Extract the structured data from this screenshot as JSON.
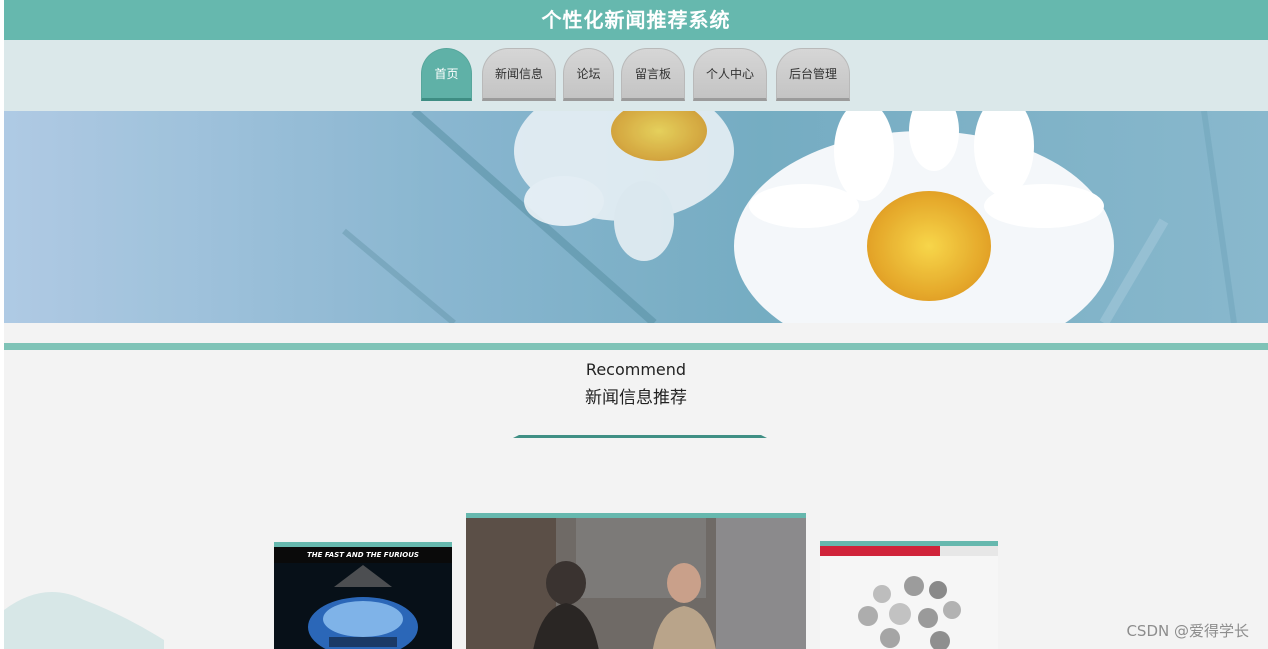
{
  "header": {
    "title": "个性化新闻推荐系统"
  },
  "nav": {
    "items": [
      {
        "label": "首页"
      },
      {
        "label": "新闻信息"
      },
      {
        "label": "论坛"
      },
      {
        "label": "留言板"
      },
      {
        "label": "个人中心"
      },
      {
        "label": "后台管理"
      }
    ]
  },
  "recommend": {
    "title_en": "Recommend",
    "title_zh": "新闻信息推荐"
  },
  "cards": {
    "left_poster_text": "THE FAST AND THE FURIOUS"
  },
  "watermark": "CSDN @爱得学长",
  "colors": {
    "accent": "#66b8ae",
    "nav_band": "#dbe8ea",
    "page_bg": "#f3f3f3"
  }
}
